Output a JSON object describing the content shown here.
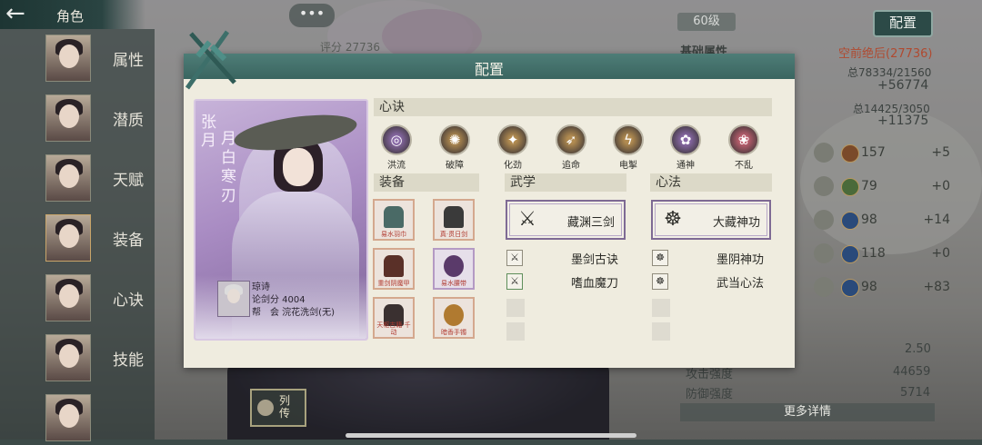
{
  "topbar": {
    "title": "角色",
    "back_icon": "←"
  },
  "sidebar": {
    "items": [
      {
        "label": "属性"
      },
      {
        "label": "潜质"
      },
      {
        "label": "天赋"
      },
      {
        "label": "装备"
      },
      {
        "label": "心诀"
      },
      {
        "label": "技能"
      }
    ]
  },
  "chat_button": "•••",
  "top_score": "评分 27736",
  "right_panel": {
    "level": "60级",
    "config_button": "配置",
    "basic_attr_label": "基础属性",
    "rank_text": "空前绝后(27736)",
    "total1_label": "总78334/21560",
    "total1_plus": "+56774",
    "total2_label": "总14425/3050",
    "total2_plus": "+11375",
    "stats": [
      {
        "badge": "甲",
        "value": "157",
        "delta": "+5"
      },
      {
        "badge": "内",
        "value": "79",
        "delta": "+0"
      },
      {
        "badge": "",
        "value": "98",
        "delta": "+14"
      },
      {
        "badge": "",
        "value": "118",
        "delta": "+0"
      },
      {
        "badge": "",
        "value": "98",
        "delta": "+83"
      }
    ],
    "ratio_value": "2.50",
    "attack_label": "攻击强度",
    "attack_value": "44659",
    "defense_label": "防御强度",
    "defense_value": "5714",
    "more_button": "更多详情"
  },
  "bio_button": "列传",
  "modal": {
    "title": "配置",
    "card": {
      "surname": "张月",
      "title": "月白寒刃",
      "player_name": "琼诗",
      "score": "论剑分 4004",
      "guild": "帮　会 浣花洗剑(无)"
    },
    "xinjue_header": "心诀",
    "xinjue": [
      {
        "label": "洪流",
        "color": "#8a6aa8",
        "glyph": "◎"
      },
      {
        "label": "破障",
        "color": "#b08a50",
        "glyph": "✺"
      },
      {
        "label": "化劲",
        "color": "#b08a50",
        "glyph": "✦"
      },
      {
        "label": "追命",
        "color": "#b08a50",
        "glyph": "➶"
      },
      {
        "label": "电掣",
        "color": "#b08a50",
        "glyph": "ϟ"
      },
      {
        "label": "通神",
        "color": "#8a6aa8",
        "glyph": "✿"
      },
      {
        "label": "不乱",
        "color": "#c06070",
        "glyph": "❀"
      }
    ],
    "equip_header": "装备",
    "equipment": [
      {
        "caption": "易水羽巾",
        "color": "#4a6a66"
      },
      {
        "caption": "真·贯日剑",
        "color": "#3a3a3a"
      },
      {
        "caption": "重剑阴魔甲",
        "color": "#5a3028"
      },
      {
        "caption": "易水腰带",
        "color": "#5a3a6a"
      },
      {
        "caption": "天枢古籍·千动",
        "color": "#3a3030"
      },
      {
        "caption": "暗香手镯",
        "color": "#b07a30"
      }
    ],
    "wuxue_header": "武学",
    "wuxue_main": "藏渊三剑",
    "wuxue_items": [
      "墨剑古诀",
      "嗜血魔刀"
    ],
    "xinfa_header": "心法",
    "xinfa_main": "大藏神功",
    "xinfa_items": [
      "墨阴神功",
      "武当心法"
    ]
  }
}
